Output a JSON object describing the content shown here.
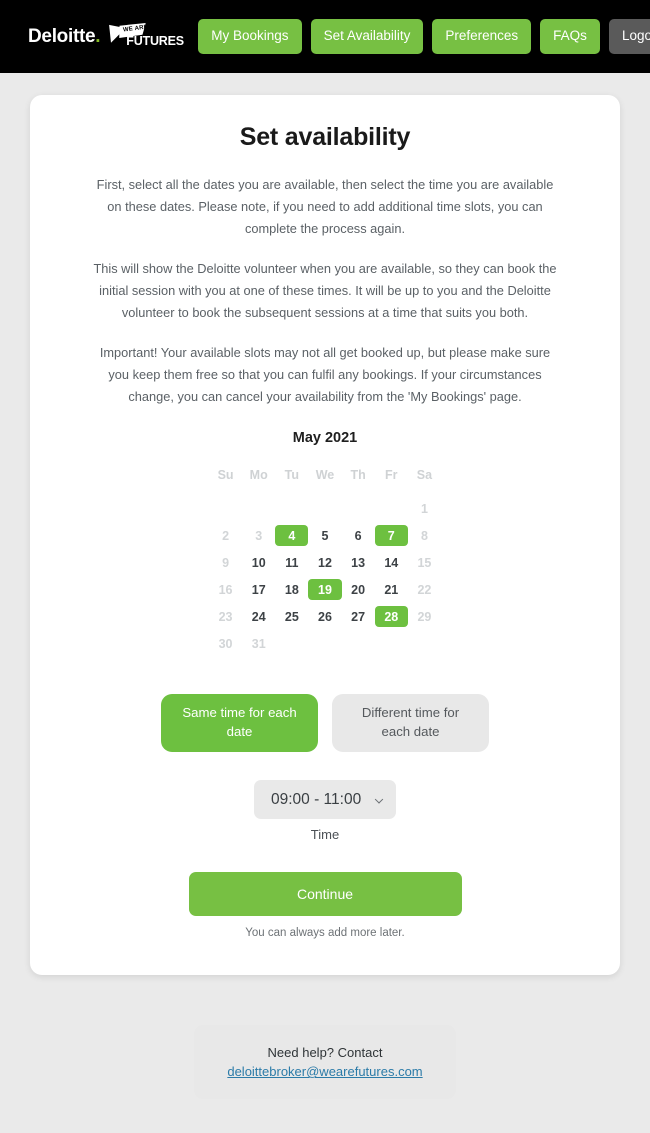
{
  "navbar": {
    "brand_primary": "Deloitte",
    "brand_dot": ".",
    "brand_secondary_small": "WE ARE",
    "brand_secondary": "FUTURES",
    "links": [
      {
        "label": "My Bookings",
        "style": "green"
      },
      {
        "label": "Set Availability",
        "style": "green"
      },
      {
        "label": "Preferences",
        "style": "green"
      },
      {
        "label": "FAQs",
        "style": "green"
      },
      {
        "label": "Logout",
        "style": "grey"
      }
    ]
  },
  "main": {
    "title": "Set availability",
    "paragraphs": [
      "First, select all the dates you are available, then select the time you are available on these dates. Please note, if you need to add additional time slots, you can complete the process again.",
      "This will show the Deloitte volunteer when you are available, so they can book the initial session with you at one of these times. It will be up to you and the Deloitte volunteer to book the subsequent sessions at a time that suits you both.",
      "Important! Your available slots may not all get booked up, but please make sure you keep them free so that you can fulfil any bookings. If your circumstances change, you can cancel your availability from the 'My Bookings' page."
    ]
  },
  "calendar": {
    "month_label": "May 2021",
    "weekdays": [
      "Su",
      "Mo",
      "Tu",
      "We",
      "Th",
      "Fr",
      "Sa"
    ],
    "selected_dates": [
      4,
      7,
      19,
      28
    ],
    "disabled_dates": [
      1,
      2,
      3,
      8,
      9,
      15,
      16,
      22,
      23,
      29,
      30,
      31
    ],
    "weeks": [
      [
        null,
        null,
        null,
        null,
        null,
        null,
        1
      ],
      [
        2,
        3,
        4,
        5,
        6,
        7,
        8
      ],
      [
        9,
        10,
        11,
        12,
        13,
        14,
        15
      ],
      [
        16,
        17,
        18,
        19,
        20,
        21,
        22
      ],
      [
        23,
        24,
        25,
        26,
        27,
        28,
        29
      ],
      [
        30,
        31,
        null,
        null,
        null,
        null,
        null
      ]
    ]
  },
  "mode": {
    "same_time_label": "Same time for each date",
    "different_time_label": "Different time for each date",
    "selected": "same"
  },
  "time": {
    "value": "09:00 - 11:00",
    "field_label": "Time",
    "chevron_icon": "chevron-down-icon",
    "options": [
      "09:00 - 11:00"
    ]
  },
  "actions": {
    "continue_label": "Continue",
    "continue_note": "You can always add more later."
  },
  "footer": {
    "help_text": "Need help? Contact",
    "help_email": "deloittebroker@wearefutures.com"
  },
  "colors": {
    "brand_green": "#86bc25",
    "button_green": "#77c043",
    "selected_green": "#6dc040",
    "logout_grey": "#5a5a5a",
    "page_background": "#eaeaea",
    "link_blue": "#2b7ba8"
  }
}
